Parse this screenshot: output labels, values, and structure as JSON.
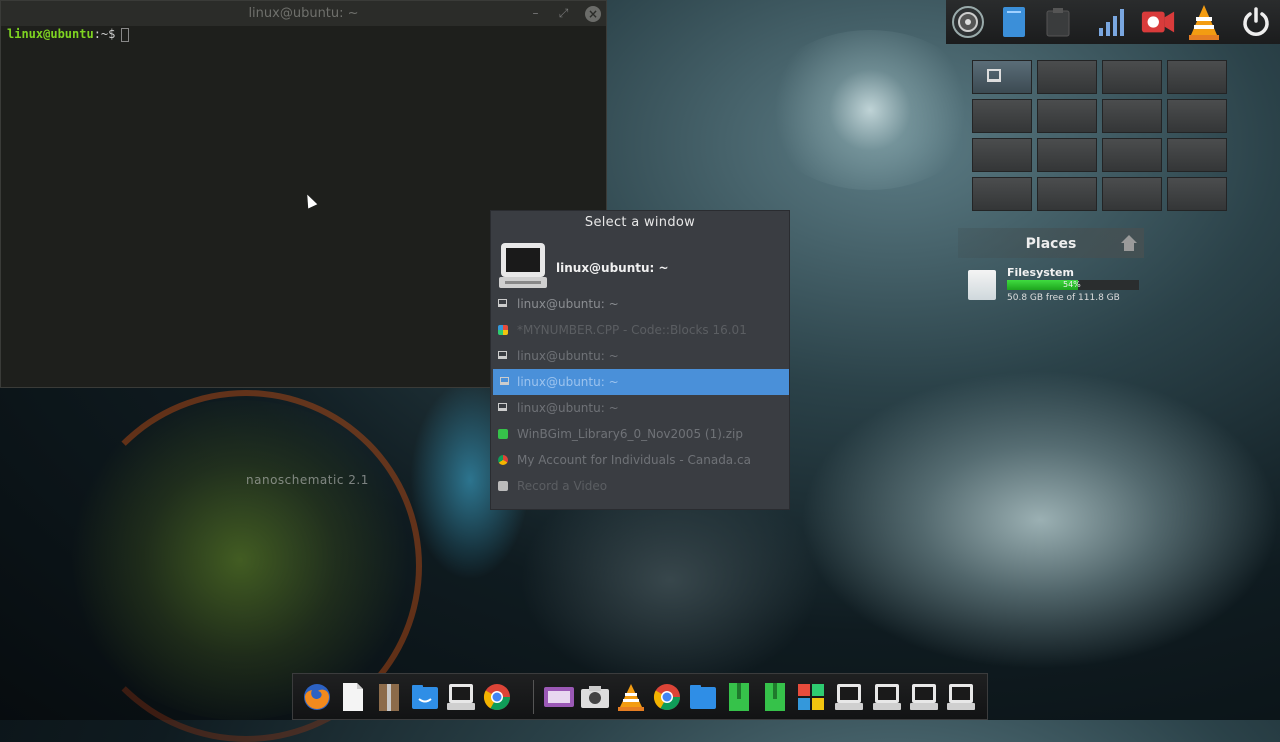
{
  "terminal": {
    "title": "linux@ubuntu: ~",
    "minimize_symbol": "–",
    "maximize_symbol": "⤢",
    "close_symbol": "×",
    "prompt_user": "linux@ubuntu",
    "prompt_path": ":~$"
  },
  "wallpaper": {
    "text": "nanoschematic 2.1"
  },
  "top_panel": {
    "icons": [
      "speaker-icon",
      "document-icon",
      "clipboard-icon",
      "signal-icon",
      "record-icon",
      "vlc-icon",
      "power-icon"
    ]
  },
  "workspaces": {
    "count": 16,
    "active_index": 0
  },
  "places": {
    "title": "Places",
    "filesystem": {
      "name": "Filesystem",
      "usage_percent": 54,
      "usage_label": "54%",
      "free_text": "50.8 GB free of 111.8 GB"
    }
  },
  "switcher": {
    "title": "Select a window",
    "current": "linux@ubuntu: ~",
    "items": [
      {
        "label": "linux@ubuntu: ~",
        "icon": "terminal-icon"
      },
      {
        "label": "*MYNUMBER.CPP - Code::Blocks 16.01",
        "icon": "codeblocks-icon"
      },
      {
        "label": "linux@ubuntu: ~",
        "icon": "terminal-icon"
      },
      {
        "label": "linux@ubuntu: ~",
        "icon": "terminal-icon",
        "selected": true
      },
      {
        "label": "linux@ubuntu: ~",
        "icon": "terminal-icon"
      },
      {
        "label": "WinBGim_Library6_0_Nov2005 (1).zip",
        "icon": "archive-icon"
      },
      {
        "label": "My Account for Individuals - Canada.ca",
        "icon": "chrome-icon"
      },
      {
        "label": "Record a Video",
        "icon": "recorder-icon"
      }
    ]
  },
  "dock": {
    "icons": [
      "firefox-icon",
      "text-editor-icon",
      "archive-manager-icon",
      "file-manager-icon",
      "terminal-icon",
      "chrome-icon",
      "screen-recorder-icon",
      "screenshot-icon",
      "vlc-icon",
      "chrome-icon",
      "file-manager-icon",
      "archive-icon",
      "archive-icon",
      "codeblocks-icon",
      "terminal-icon",
      "terminal-icon",
      "terminal-icon",
      "terminal-icon"
    ]
  }
}
